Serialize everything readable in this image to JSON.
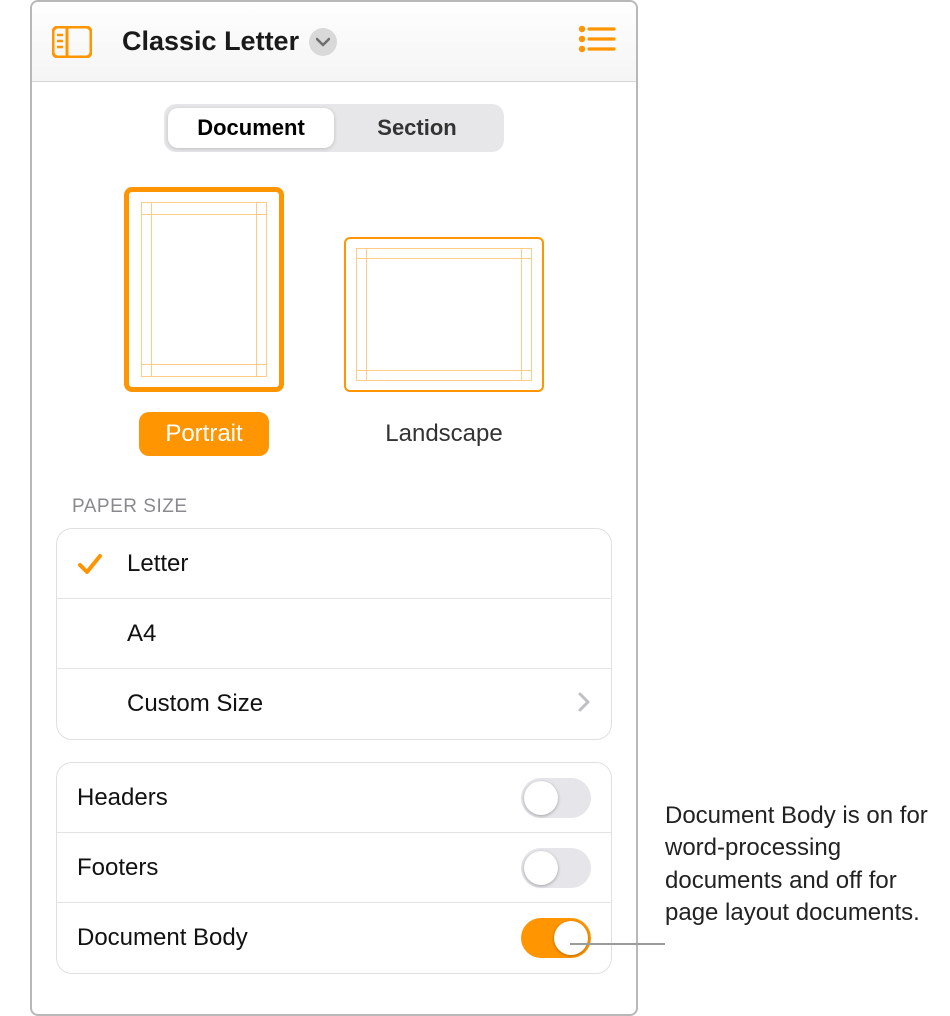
{
  "toolbar": {
    "title": "Classic Letter"
  },
  "tabs": {
    "document": "Document",
    "section": "Section",
    "active": "document"
  },
  "orientation": {
    "portrait_label": "Portrait",
    "landscape_label": "Landscape",
    "selected": "portrait"
  },
  "paper_size": {
    "header": "PAPER SIZE",
    "options": [
      {
        "label": "Letter",
        "selected": true,
        "disclosure": false
      },
      {
        "label": "A4",
        "selected": false,
        "disclosure": false
      },
      {
        "label": "Custom Size",
        "selected": false,
        "disclosure": true
      }
    ]
  },
  "toggles": [
    {
      "label": "Headers",
      "on": false
    },
    {
      "label": "Footers",
      "on": false
    },
    {
      "label": "Document Body",
      "on": true
    }
  ],
  "callout": "Document Body is on for word-processing documents and off for page layout documents."
}
